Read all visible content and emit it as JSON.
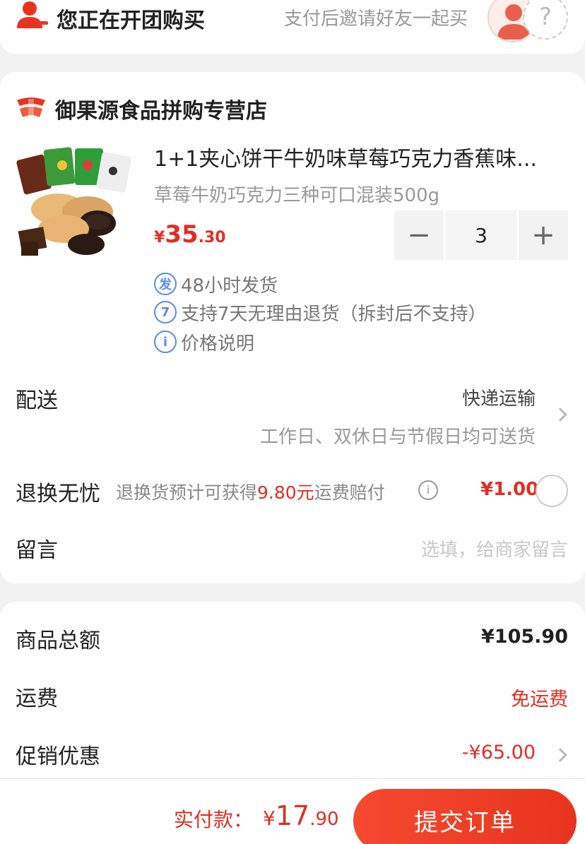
{
  "group": {
    "title": "您正在开团购买",
    "hint": "支付后邀请好友一起买",
    "empty_avatar_mark": "?"
  },
  "store": {
    "name": "御果源食品拼购专营店"
  },
  "product": {
    "title": "1+1夹心饼干牛奶味草莓巧克力香蕉味...",
    "spec": "草莓牛奶巧克力三种可口混装500g",
    "price_currency": "¥",
    "price_int": "35",
    "price_dec": ".30",
    "quantity": "3",
    "minus": "−",
    "plus": "+"
  },
  "services": [
    {
      "badge": "发",
      "text": "48小时发货"
    },
    {
      "badge": "7",
      "text": "支持7天无理由退货（拆封后不支持）"
    },
    {
      "badge": "i",
      "text": "价格说明"
    }
  ],
  "delivery": {
    "label": "配送",
    "method": "快递运输",
    "desc": "工作日、双休日与节假日均可送货"
  },
  "return_insurance": {
    "label": "退换无忧",
    "desc_prefix": "退换货预计可获得",
    "desc_highlight": "9.80元",
    "desc_suffix": "运费赔付",
    "info_mark": "i",
    "price": "¥1.00"
  },
  "message": {
    "label": "留言",
    "placeholder": "选填，给商家留言"
  },
  "summary": {
    "goods_total_label": "商品总额",
    "goods_total_value": "¥105.90",
    "shipping_label": "运费",
    "shipping_value": "免运费",
    "promo_label": "促销优惠",
    "promo_value": "-¥65.00"
  },
  "footer": {
    "pay_label": "实付款：",
    "pay_currency": "¥",
    "pay_int": "17",
    "pay_dec": ".90",
    "submit_label": "提交订单"
  },
  "colors": {
    "accent_red": "#e02e24",
    "service_blue": "#5b8ee0"
  }
}
